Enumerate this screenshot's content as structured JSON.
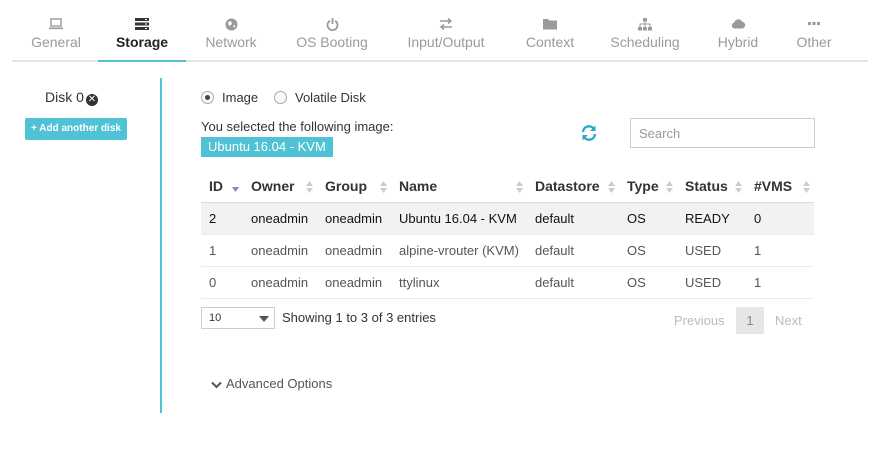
{
  "tabs": [
    {
      "label": "General",
      "icon": "laptop-icon"
    },
    {
      "label": "Storage",
      "icon": "server-icon"
    },
    {
      "label": "Network",
      "icon": "globe-icon"
    },
    {
      "label": "OS Booting",
      "icon": "power-icon"
    },
    {
      "label": "Input/Output",
      "icon": "exchange-icon"
    },
    {
      "label": "Context",
      "icon": "folder-icon"
    },
    {
      "label": "Scheduling",
      "icon": "sitemap-icon"
    },
    {
      "label": "Hybrid",
      "icon": "cloud-icon"
    },
    {
      "label": "Other",
      "icon": "ellipsis-icon"
    }
  ],
  "active_tab": "Storage",
  "sidebar": {
    "disk_label": "Disk 0",
    "add_disk_label": "Add another disk"
  },
  "disk_type": {
    "options": [
      "Image",
      "Volatile Disk"
    ],
    "selected": "Image"
  },
  "selection": {
    "prompt": "You selected the following image:",
    "selected_image": "Ubuntu 16.04 - KVM"
  },
  "search": {
    "placeholder": "Search",
    "value": ""
  },
  "table": {
    "columns": [
      "ID",
      "Owner",
      "Group",
      "Name",
      "Datastore",
      "Type",
      "Status",
      "#VMS"
    ],
    "rows": [
      [
        "2",
        "oneadmin",
        "oneadmin",
        "Ubuntu 16.04 - KVM",
        "default",
        "OS",
        "READY",
        "0"
      ],
      [
        "1",
        "oneadmin",
        "oneadmin",
        "alpine-vrouter (KVM)",
        "default",
        "OS",
        "USED",
        "1"
      ],
      [
        "0",
        "oneadmin",
        "oneadmin",
        "ttylinux",
        "default",
        "OS",
        "USED",
        "1"
      ]
    ],
    "selected_row": 0
  },
  "pagination": {
    "per_page": "10",
    "info": "Showing 1 to 3 of 3 entries",
    "previous_label": "Previous",
    "page": "1",
    "next_label": "Next"
  },
  "advanced_label": "Advanced Options",
  "colors": {
    "accent": "#4fc3d5",
    "selected_row": "#f2f2f2"
  }
}
